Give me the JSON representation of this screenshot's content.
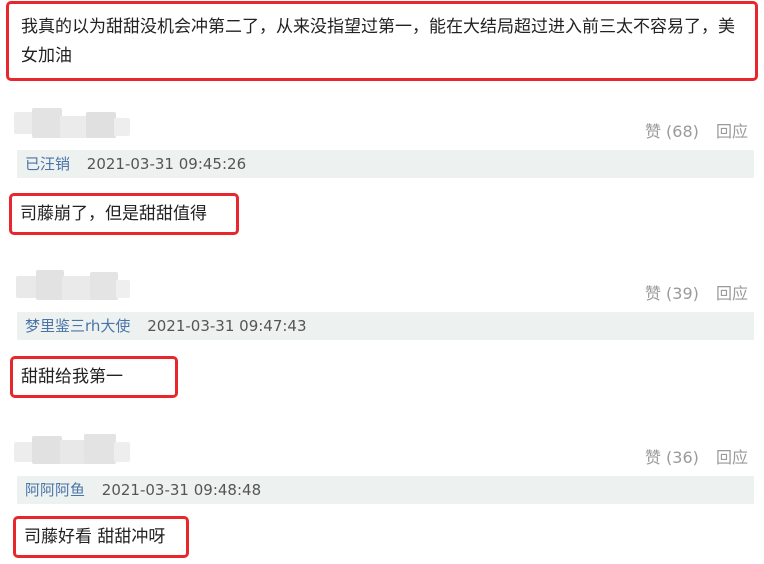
{
  "top_comment": {
    "text": "我真的以为甜甜没机会冲第二了，从来没指望过第一，能在大结局超过进入前三太不容易了，美女加油"
  },
  "comments": [
    {
      "like_label": "赞 (68)",
      "reply_label": "回应",
      "author": "已汪销",
      "time": "2021-03-31 09:45:26",
      "text": "司藤崩了，但是甜甜值得"
    },
    {
      "like_label": "赞 (39)",
      "reply_label": "回应",
      "author": "梦里鉴三rh大使",
      "time": "2021-03-31 09:47:43",
      "text": "甜甜给我第一"
    },
    {
      "like_label": "赞 (36)",
      "reply_label": "回应",
      "author": "阿阿阿鱼",
      "time": "2021-03-31 09:48:48",
      "text": "司藤好看 甜甜冲呀"
    }
  ],
  "colors": {
    "highlight_border": "#e8262b",
    "author_link": "#4a74a8",
    "info_bar_bg": "#edf2f1",
    "muted_text": "#9a9a9a"
  }
}
